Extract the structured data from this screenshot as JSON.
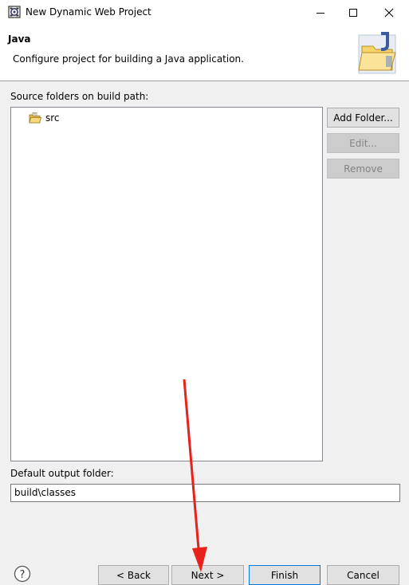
{
  "window": {
    "title": "New Dynamic Web Project"
  },
  "banner": {
    "title": "Java",
    "description": "Configure project for building a Java application."
  },
  "source_folders": {
    "label": "Source folders on build path:",
    "items": [
      {
        "name": "src",
        "icon": "source-folder-icon"
      }
    ]
  },
  "side_buttons": {
    "add_folder": "Add Folder...",
    "edit": "Edit...",
    "remove": "Remove"
  },
  "output_folder": {
    "label": "Default output folder:",
    "value": "build\\classes"
  },
  "footer": {
    "help_icon": "help-icon",
    "back": "< Back",
    "next": "Next >",
    "finish": "Finish",
    "cancel": "Cancel"
  },
  "colors": {
    "annotation_arrow": "#e8211a",
    "focus_border": "#0078d7"
  }
}
